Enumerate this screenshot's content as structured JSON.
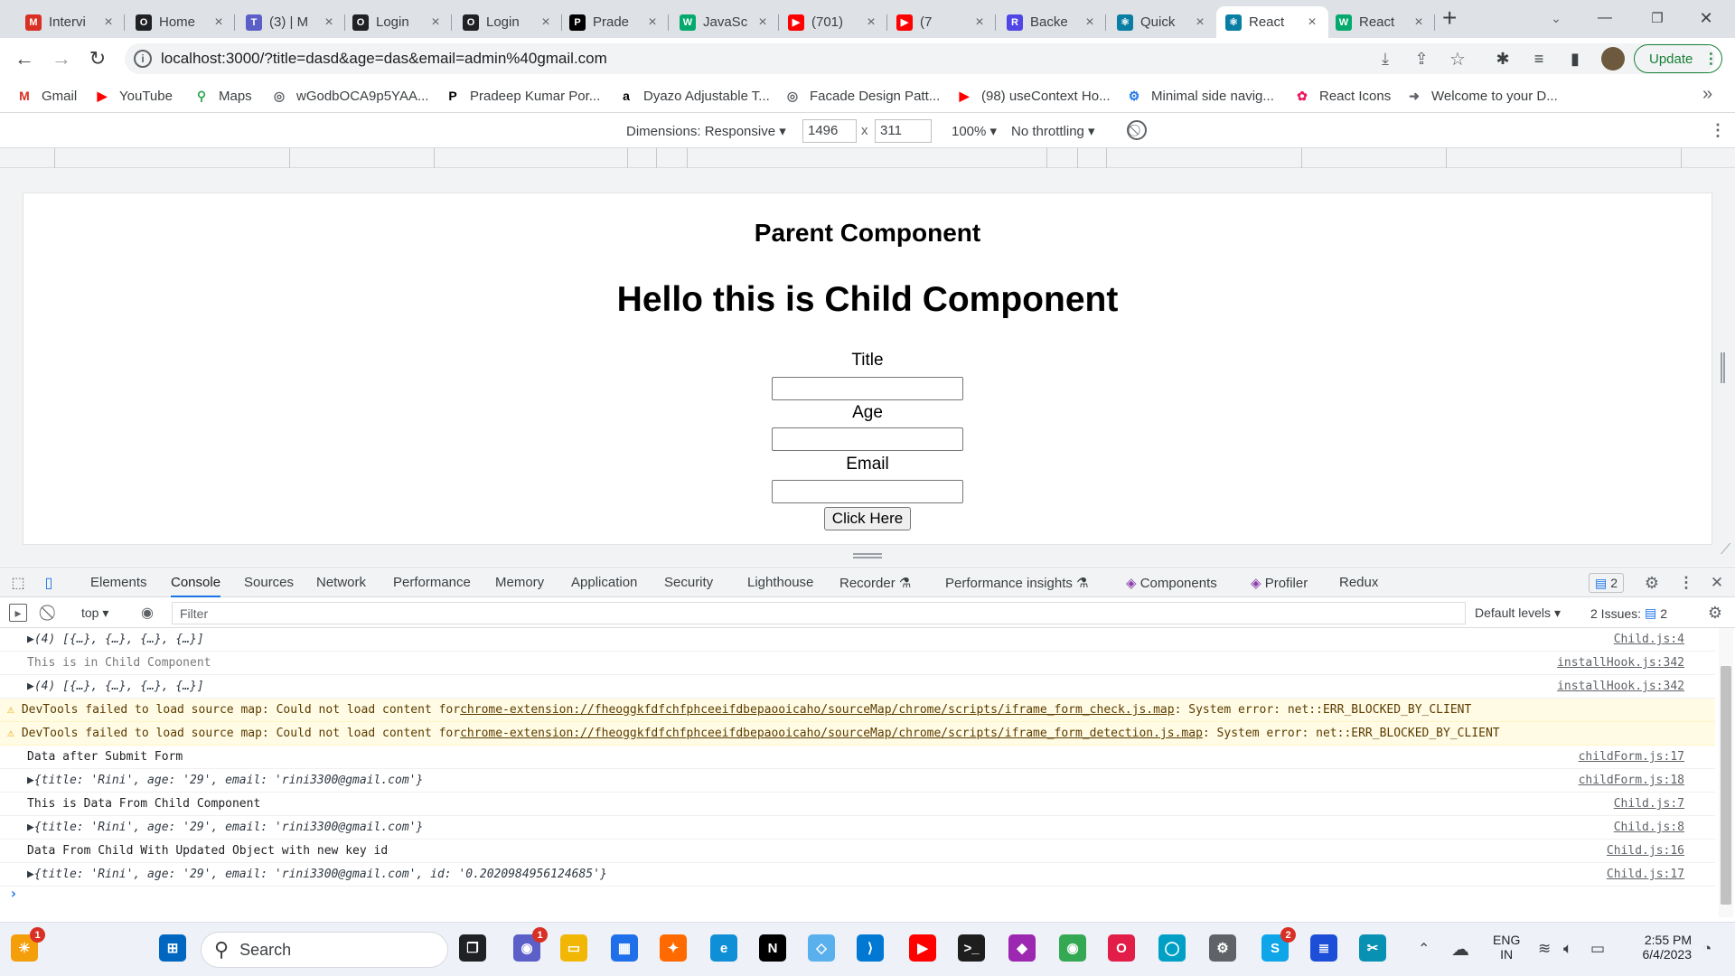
{
  "browser": {
    "tabs": [
      {
        "label": "Intervi",
        "icon": "gmail-icon",
        "color": "#d93025",
        "glyph": "M"
      },
      {
        "label": "Home",
        "icon": "opera-icon",
        "color": "#202124",
        "glyph": "O"
      },
      {
        "label": "(3) | M",
        "icon": "teams-icon",
        "color": "#5b5fc7",
        "glyph": "T"
      },
      {
        "label": "Login",
        "icon": "opera-icon",
        "color": "#202124",
        "glyph": "O"
      },
      {
        "label": "Login",
        "icon": "opera-icon",
        "color": "#202124",
        "glyph": "O"
      },
      {
        "label": "Prade",
        "icon": "p-icon",
        "color": "#000000",
        "glyph": "P"
      },
      {
        "label": "JavaSc",
        "icon": "w3schools-icon",
        "color": "#04aa6d",
        "glyph": "W"
      },
      {
        "label": "(701)",
        "icon": "youtube-icon",
        "color": "#ff0000",
        "glyph": "▶"
      },
      {
        "label": "(7",
        "icon": "youtube-icon",
        "color": "#ff0000",
        "glyph": "▶"
      },
      {
        "label": "Backe",
        "icon": "r-icon",
        "color": "#4f46e5",
        "glyph": "R"
      },
      {
        "label": "Quick",
        "icon": "react-icon",
        "color": "#087ea4",
        "glyph": "⚛"
      },
      {
        "label": "React",
        "icon": "react-icon",
        "color": "#087ea4",
        "glyph": "⚛"
      },
      {
        "label": "React",
        "icon": "w3schools-icon",
        "color": "#04aa6d",
        "glyph": "W"
      }
    ],
    "new_tab": "+",
    "url": "localhost:3000/?title=dasd&age=das&email=admin%40gmail.com",
    "update_label": "Update",
    "bookmarks": [
      {
        "label": "Gmail",
        "glyph": "M",
        "color": "#d93025"
      },
      {
        "label": "YouTube",
        "glyph": "▶",
        "color": "#ff0000"
      },
      {
        "label": "Maps",
        "glyph": "⚲",
        "color": "#34a853"
      },
      {
        "label": "wGodbOCA9p5YAA...",
        "glyph": "◎",
        "color": "#5f6368"
      },
      {
        "label": "Pradeep Kumar Por...",
        "glyph": "P",
        "color": "#000000"
      },
      {
        "label": "Dyazo Adjustable T...",
        "glyph": "a",
        "color": "#000000"
      },
      {
        "label": "Facade Design Patt...",
        "glyph": "◎",
        "color": "#5f6368"
      },
      {
        "label": "(98) useContext Ho...",
        "glyph": "▶",
        "color": "#ff0000"
      },
      {
        "label": "Minimal side navig...",
        "glyph": "⚙",
        "color": "#1a73e8"
      },
      {
        "label": "React Icons",
        "glyph": "✿",
        "color": "#e91e63"
      },
      {
        "label": "Welcome to your D...",
        "glyph": "➜",
        "color": "#5f6368"
      }
    ],
    "bookmarks_more": "»"
  },
  "device_toolbar": {
    "dimensions_label": "Dimensions: Responsive",
    "width": "1496",
    "times": "x",
    "height": "311",
    "zoom": "100%",
    "throttling": "No throttling"
  },
  "page": {
    "parent_heading": "Parent Component",
    "child_heading": "Hello this is Child Component",
    "title_label": "Title",
    "age_label": "Age",
    "email_label": "Email",
    "button_label": "Click Here"
  },
  "devtools": {
    "tabs": [
      "Elements",
      "Console",
      "Sources",
      "Network",
      "Performance",
      "Memory",
      "Application",
      "Security",
      "Lighthouse",
      "Recorder",
      "Performance insights",
      "Components",
      "Profiler",
      "Redux"
    ],
    "active_tab": "Console",
    "issues_badge": "2",
    "context": "top",
    "filter_placeholder": "Filter",
    "levels": "Default levels",
    "issues_label": "2 Issues:",
    "issues_count": "2",
    "console_rows": [
      {
        "kind": "obj",
        "text": "▶(4) [{…}, {…}, {…}, {…}]",
        "src": "Child.js:4"
      },
      {
        "kind": "dim",
        "text": "This is in Child Component",
        "src": "installHook.js:342"
      },
      {
        "kind": "obj",
        "text": "▶(4) [{…}, {…}, {…}, {…}]",
        "src": "installHook.js:342"
      },
      {
        "kind": "warn",
        "text": "DevTools failed to load source map: Could not load content for ",
        "link": "chrome-extension://fheoggkfdfchfphceeifdbepaooicaho/sourceMap/chrome/scripts/iframe_form_check.js.map",
        "tail": ": System error: net::ERR_BLOCKED_BY_CLIENT",
        "src": ""
      },
      {
        "kind": "warn",
        "text": "DevTools failed to load source map: Could not load content for ",
        "link": "chrome-extension://fheoggkfdfchfphceeifdbepaooicaho/sourceMap/chrome/scripts/iframe_form_detection.js.map",
        "tail": ": System error: net::ERR_BLOCKED_BY_CLIENT",
        "src": ""
      },
      {
        "kind": "log",
        "text": "Data after Submit Form",
        "src": "childForm.js:17"
      },
      {
        "kind": "obj",
        "text": "▶{title: 'Rini', age: '29', email: 'rini3300@gmail.com'}",
        "src": "childForm.js:18"
      },
      {
        "kind": "log",
        "text": "This is Data From Child Component",
        "src": "Child.js:7"
      },
      {
        "kind": "obj",
        "text": "▶{title: 'Rini', age: '29', email: 'rini3300@gmail.com'}",
        "src": "Child.js:8"
      },
      {
        "kind": "log",
        "text": "Data From Child With Updated Object with new key id",
        "src": "Child.js:16"
      },
      {
        "kind": "obj",
        "text": "▶{title: 'Rini', age: '29', email: 'rini3300@gmail.com', id: '0.2020984956124685'}",
        "src": "Child.js:17"
      }
    ],
    "prompt": "›"
  },
  "taskbar": {
    "search_label": "Search",
    "lang": "ENG",
    "region": "IN",
    "time": "2:55 PM",
    "date": "6/4/2023",
    "apps": [
      {
        "name": "weather-icon",
        "color": "#f59e0b",
        "glyph": "☀",
        "badge": "1"
      },
      {
        "name": "start-icon",
        "color": "#0067c0",
        "glyph": "⊞",
        "badge": ""
      },
      {
        "name": "task-view-icon",
        "color": "#202124",
        "glyph": "❐",
        "badge": ""
      },
      {
        "name": "teams-chat-icon",
        "color": "#5b5fc7",
        "glyph": "◉",
        "badge": "1"
      },
      {
        "name": "file-explorer-icon",
        "color": "#f2b705",
        "glyph": "▭",
        "badge": ""
      },
      {
        "name": "store-icon",
        "color": "#1f6feb",
        "glyph": "▦",
        "badge": ""
      },
      {
        "name": "app-orange-icon",
        "color": "#ff6a00",
        "glyph": "✦",
        "badge": ""
      },
      {
        "name": "edge-icon",
        "color": "#0f8fd6",
        "glyph": "e",
        "badge": ""
      },
      {
        "name": "netflix-icon",
        "color": "#000000",
        "glyph": "N",
        "badge": ""
      },
      {
        "name": "app-blue-icon",
        "color": "#5ab0ec",
        "glyph": "◇",
        "badge": ""
      },
      {
        "name": "vscode-icon",
        "color": "#0078d4",
        "glyph": "⟩",
        "badge": ""
      },
      {
        "name": "youtube-app-icon",
        "color": "#ff0000",
        "glyph": "▶",
        "badge": ""
      },
      {
        "name": "terminal-icon",
        "color": "#1e1e1e",
        "glyph": ">_",
        "badge": ""
      },
      {
        "name": "app-colorful-icon",
        "color": "#9c27b0",
        "glyph": "◆",
        "badge": ""
      },
      {
        "name": "chrome-icon",
        "color": "#34a853",
        "glyph": "◉",
        "badge": ""
      },
      {
        "name": "opera-icon",
        "color": "#e11d48",
        "glyph": "O",
        "badge": ""
      },
      {
        "name": "alexa-icon",
        "color": "#00a0c6",
        "glyph": "◯",
        "badge": ""
      },
      {
        "name": "settings-icon",
        "color": "#5f6368",
        "glyph": "⚙",
        "badge": ""
      },
      {
        "name": "skype-icon",
        "color": "#0ea5e9",
        "glyph": "S",
        "badge": "2"
      },
      {
        "name": "notepad-icon",
        "color": "#1d4ed8",
        "glyph": "≣",
        "badge": ""
      },
      {
        "name": "snipping-icon",
        "color": "#0891b2",
        "glyph": "✂",
        "badge": ""
      }
    ]
  }
}
